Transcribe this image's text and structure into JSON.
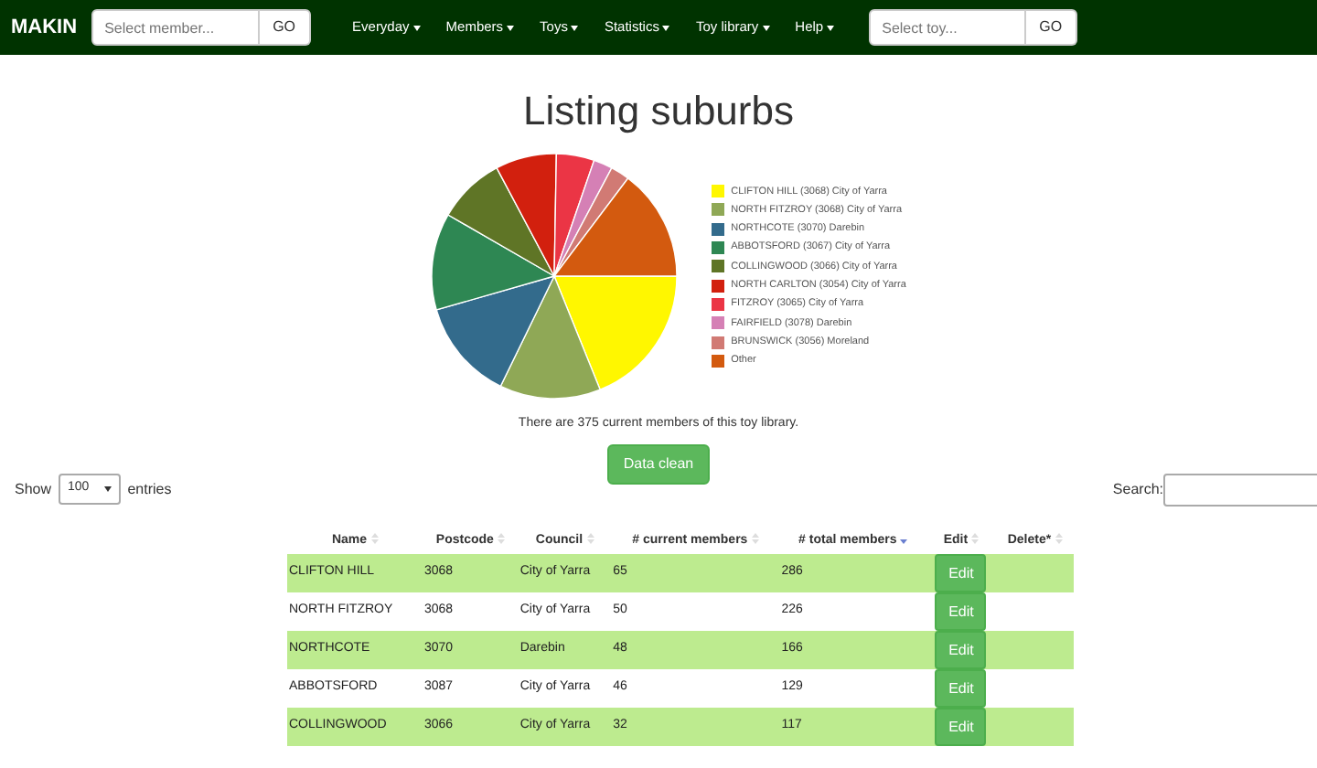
{
  "navbar": {
    "brand": "MAKIN",
    "member_search": {
      "placeholder": "Select member...",
      "button": "GO"
    },
    "menus": [
      "Everyday",
      "Members",
      "Toys",
      "Statistics",
      "Toy library",
      "Help"
    ],
    "toy_search": {
      "placeholder": "Select toy...",
      "button": "GO"
    }
  },
  "title": "Listing suburbs",
  "legend": [
    {
      "label": "CLIFTON HILL (3068) City of Yarra",
      "color": "#fff700"
    },
    {
      "label": "NORTH FITZROY (3068) City of Yarra",
      "color": "#8fa856"
    },
    {
      "label": "NORTHCOTE (3070) Darebin",
      "color": "#336b8c"
    },
    {
      "label": "ABBOTSFORD (3067) City of Yarra",
      "color": "#2e8753"
    },
    {
      "label": "COLLINGWOOD (3066) City of Yarra",
      "color": "#5f7526"
    },
    {
      "label": "NORTH CARLTON (3054) City of Yarra",
      "color": "#d2200e"
    },
    {
      "label": "FITZROY (3065) City of Yarra",
      "color": "#eb3545"
    },
    {
      "label": "FAIRFIELD (3078) Darebin",
      "color": "#d580b5"
    },
    {
      "label": "BRUNSWICK (3056) Moreland",
      "color": "#d17a74"
    },
    {
      "label": "Other",
      "color": "#d35a0f"
    }
  ],
  "summary": "There are 375 current members of this toy library.",
  "clean_button": "Data clean",
  "length": {
    "before": "Show",
    "value": "100",
    "after": "entries"
  },
  "search_label": "Search:",
  "table": {
    "columns": [
      {
        "label": "Name",
        "sorted": false
      },
      {
        "label": "Postcode",
        "sorted": false
      },
      {
        "label": "Council",
        "sorted": false
      },
      {
        "label": "# current members",
        "sorted": false
      },
      {
        "label": "# total members",
        "sorted": true
      },
      {
        "label": "Edit",
        "sorted": false
      },
      {
        "label": "Delete*",
        "sorted": false
      }
    ],
    "rows": [
      {
        "cells": [
          "CLIFTON HILL",
          "3068",
          "City of Yarra",
          "65",
          "286"
        ],
        "edit": "Edit"
      },
      {
        "cells": [
          "NORTH FITZROY",
          "3068",
          "City of Yarra",
          "50",
          "226"
        ],
        "edit": "Edit"
      },
      {
        "cells": [
          "NORTHCOTE",
          "3070",
          "Darebin",
          "48",
          "166"
        ],
        "edit": "Edit"
      },
      {
        "cells": [
          "ABBOTSFORD",
          "3087",
          "City of Yarra",
          "46",
          "129"
        ],
        "edit": "Edit"
      },
      {
        "cells": [
          "COLLINGWOOD",
          "3066",
          "City of Yarra",
          "32",
          "117"
        ],
        "edit": "Edit"
      }
    ]
  }
}
